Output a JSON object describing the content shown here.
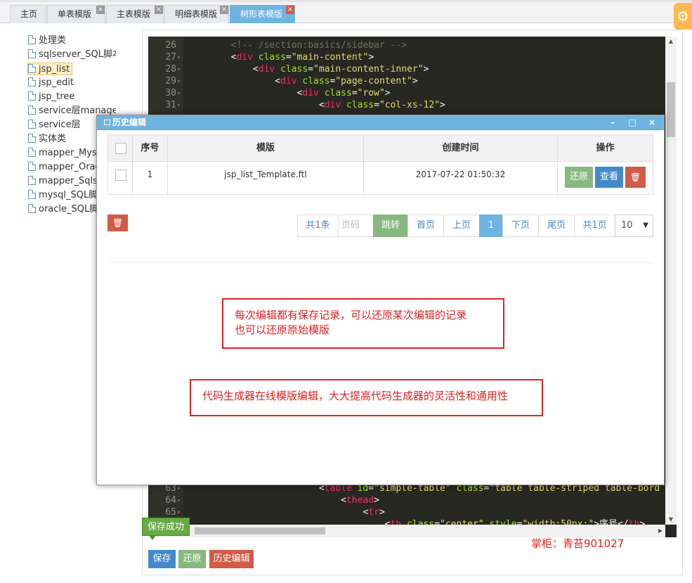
{
  "tabs": [
    {
      "label": "主页",
      "closable": false,
      "active": false
    },
    {
      "label": "单表模版",
      "closable": true,
      "active": false
    },
    {
      "label": "主表模版",
      "closable": true,
      "active": false
    },
    {
      "label": "明细表模版",
      "closable": true,
      "active": false
    },
    {
      "label": "树形表模版",
      "closable": true,
      "active": true
    }
  ],
  "close_glyph": "×",
  "gear_glyph": "⚙",
  "tree": {
    "items": [
      "处理类",
      "sqlserver_SQL脚本",
      "jsp_list",
      "jsp_edit",
      "jsp_tree",
      "service层manager",
      "service层",
      "实体类",
      "mapper_Mysql",
      "mapper_Oracle",
      "mapper_Sqlserver",
      "mysql_SQL脚本",
      "oracle_SQL脚本"
    ],
    "selected": "jsp_list"
  },
  "code_top": [
    {
      "n": "26",
      "fold": false,
      "indent": "        ",
      "parts": [
        [
          "cm",
          "<!-- /section:basics/sidebar -->"
        ]
      ]
    },
    {
      "n": "27",
      "fold": true,
      "indent": "        ",
      "parts": [
        [
          "br",
          "<"
        ],
        [
          "tag",
          "div"
        ],
        [
          "br",
          " "
        ],
        [
          "attr",
          "class"
        ],
        [
          "br",
          "="
        ],
        [
          "str",
          "\"main-content\""
        ],
        [
          "br",
          ">"
        ]
      ]
    },
    {
      "n": "28",
      "fold": true,
      "indent": "            ",
      "parts": [
        [
          "br",
          "<"
        ],
        [
          "tag",
          "div"
        ],
        [
          "br",
          " "
        ],
        [
          "attr",
          "class"
        ],
        [
          "br",
          "="
        ],
        [
          "str",
          "\"main-content-inner\""
        ],
        [
          "br",
          ">"
        ]
      ]
    },
    {
      "n": "29",
      "fold": true,
      "indent": "                ",
      "parts": [
        [
          "br",
          "<"
        ],
        [
          "tag",
          "div"
        ],
        [
          "br",
          " "
        ],
        [
          "attr",
          "class"
        ],
        [
          "br",
          "="
        ],
        [
          "str",
          "\"page-content\""
        ],
        [
          "br",
          ">"
        ]
      ]
    },
    {
      "n": "30",
      "fold": true,
      "indent": "                    ",
      "parts": [
        [
          "br",
          "<"
        ],
        [
          "tag",
          "div"
        ],
        [
          "br",
          " "
        ],
        [
          "attr",
          "class"
        ],
        [
          "br",
          "="
        ],
        [
          "str",
          "\"row\""
        ],
        [
          "br",
          ">"
        ]
      ]
    },
    {
      "n": "31",
      "fold": true,
      "indent": "                        ",
      "parts": [
        [
          "br",
          "<"
        ],
        [
          "tag",
          "div"
        ],
        [
          "br",
          " "
        ],
        [
          "attr",
          "class"
        ],
        [
          "br",
          "="
        ],
        [
          "str",
          "\"col-xs-12\""
        ],
        [
          "br",
          ">"
        ]
      ]
    }
  ],
  "code_bottom": [
    {
      "n": "63",
      "fold": true,
      "indent": "                        ",
      "parts": [
        [
          "br",
          "<"
        ],
        [
          "tag",
          "table"
        ],
        [
          "br",
          " "
        ],
        [
          "attr",
          "id"
        ],
        [
          "br",
          "="
        ],
        [
          "str",
          "\"simple-table\""
        ],
        [
          "br",
          " "
        ],
        [
          "attr",
          "class"
        ],
        [
          "br",
          "="
        ],
        [
          "str",
          "\"table table-striped table-bord"
        ]
      ]
    },
    {
      "n": "64",
      "fold": true,
      "indent": "                            ",
      "parts": [
        [
          "br",
          "<"
        ],
        [
          "tag",
          "thead"
        ],
        [
          "br",
          ">"
        ]
      ]
    },
    {
      "n": "65",
      "fold": true,
      "indent": "                                ",
      "parts": [
        [
          "br",
          "<"
        ],
        [
          "tag",
          "tr"
        ],
        [
          "br",
          ">"
        ]
      ]
    },
    {
      "n": "",
      "fold": false,
      "indent": "                                    ",
      "parts": [
        [
          "br",
          "<"
        ],
        [
          "tag",
          "th"
        ],
        [
          "br",
          " "
        ],
        [
          "attr",
          "class"
        ],
        [
          "br",
          "="
        ],
        [
          "str",
          "\"center\""
        ],
        [
          "br",
          " "
        ],
        [
          "attr",
          "style"
        ],
        [
          "br",
          "="
        ],
        [
          "str",
          "\"width:50px;\""
        ],
        [
          "br",
          ">序号</"
        ],
        [
          "tag",
          "th"
        ],
        [
          "br",
          ">"
        ]
      ]
    }
  ],
  "buttons": {
    "save": "保存",
    "restore": "还原",
    "history": "历史编辑"
  },
  "toast": "保存成功",
  "watermark": "掌柜：青苔901027",
  "dialog": {
    "title": "历史编辑",
    "minimize": "–",
    "maximize": "□",
    "close": "×",
    "columns": [
      "序号",
      "模版",
      "创建时间",
      "操作"
    ],
    "rows": [
      {
        "no": "1",
        "template": "jsp_list_Template.ftl",
        "created": "2017-07-22 01:50:32"
      }
    ],
    "row_actions": {
      "restore": "还原",
      "view": "查看"
    },
    "delete_glyph": "🗑",
    "pagination": {
      "total_prefix": "共",
      "total_count": "1",
      "total_suffix": "条",
      "page_input_placeholder": "页码",
      "jump": "跳转",
      "first": "首页",
      "prev": "上页",
      "current": "1",
      "next": "下页",
      "last": "尾页",
      "pages_prefix": "共",
      "pages_count": "1",
      "pages_suffix": "页",
      "page_size": "10"
    }
  },
  "notes": [
    "每次编辑都有保存记录，可以还原某次编辑的记录\n也可以还原原始模版",
    "代码生成器在线模版编辑，大大提高代码生成器的灵活性和通用性"
  ],
  "colors": {
    "accent": "#6fb3e0",
    "primary": "#428bca",
    "success": "#87b87f",
    "danger": "#d15b47",
    "annotation": "#e02020"
  }
}
